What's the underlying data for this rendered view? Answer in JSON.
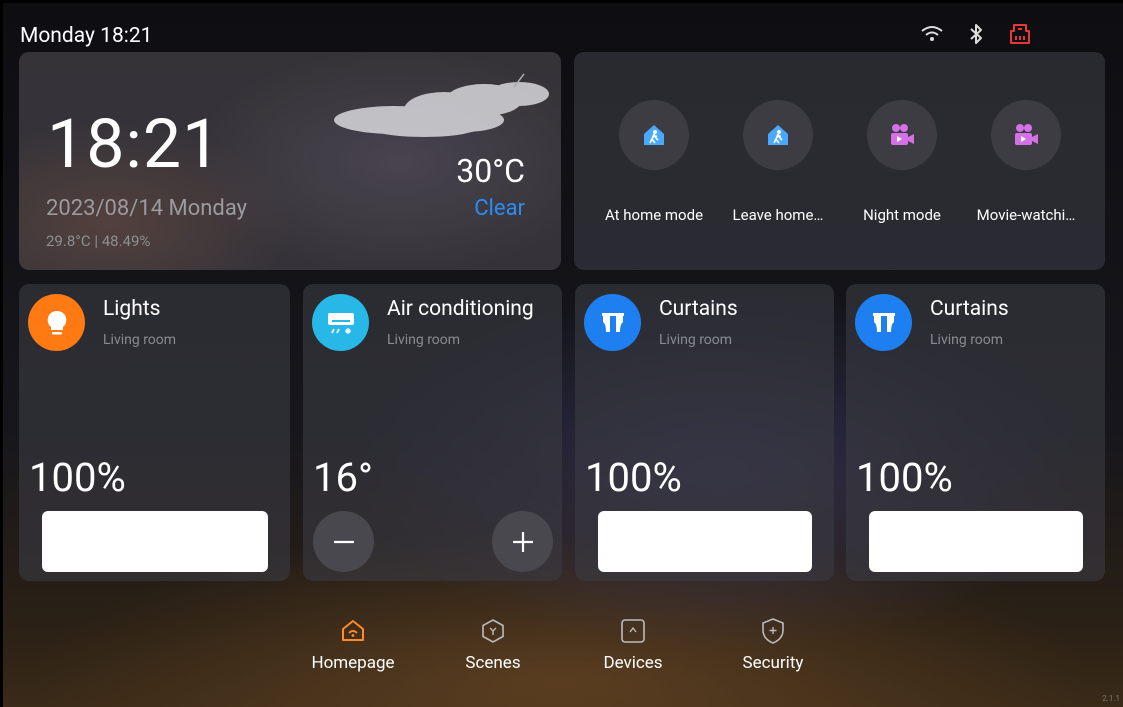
{
  "status": {
    "time_label": "Monday 18:21",
    "icons": [
      "wifi-icon",
      "bluetooth-icon",
      "network-alert-icon"
    ],
    "alert_color": "#e53935"
  },
  "weather": {
    "time": "18:21",
    "date": "2023/08/14 Monday",
    "indoor": "29.8°C | 48.49%",
    "temperature": "30°C",
    "condition": "Clear",
    "condition_color": "#2d8cf0",
    "icon": "cloud-icon"
  },
  "scenes": [
    {
      "label": "At home mode",
      "icon": "home-walk-icon",
      "color": "#4aa8ff"
    },
    {
      "label": "Leave home…",
      "icon": "home-walk-icon",
      "color": "#4aa8ff"
    },
    {
      "label": "Night mode",
      "icon": "video-camera-icon",
      "color": "#d670e6"
    },
    {
      "label": "Movie-watchi…",
      "icon": "video-camera-icon",
      "color": "#d670e6"
    }
  ],
  "devices": [
    {
      "name": "Lights",
      "room": "Living room",
      "value": "100%",
      "icon": "bulb-icon",
      "icon_bg": "#ff7a12",
      "level": 1.0
    },
    {
      "name": "Air conditioning",
      "room": "Living room",
      "value": "16°",
      "icon": "air-conditioner-icon",
      "icon_bg": "#28b8e8"
    },
    {
      "name": "Curtains",
      "room": "Living room",
      "value": "100%",
      "icon": "curtain-icon",
      "icon_bg": "#1e7ff0",
      "level": 1.0
    },
    {
      "name": "Curtains",
      "room": "Living room",
      "value": "100%",
      "icon": "curtain-icon",
      "icon_bg": "#1e7ff0",
      "level": 1.0
    }
  ],
  "nav": [
    {
      "label": "Homepage",
      "icon": "home-icon",
      "active": true
    },
    {
      "label": "Scenes",
      "icon": "scenes-icon",
      "active": false
    },
    {
      "label": "Devices",
      "icon": "devices-icon",
      "active": false
    },
    {
      "label": "Security",
      "icon": "shield-icon",
      "active": false
    }
  ],
  "active_color": "#ff8a2a",
  "version": "2.1.1"
}
